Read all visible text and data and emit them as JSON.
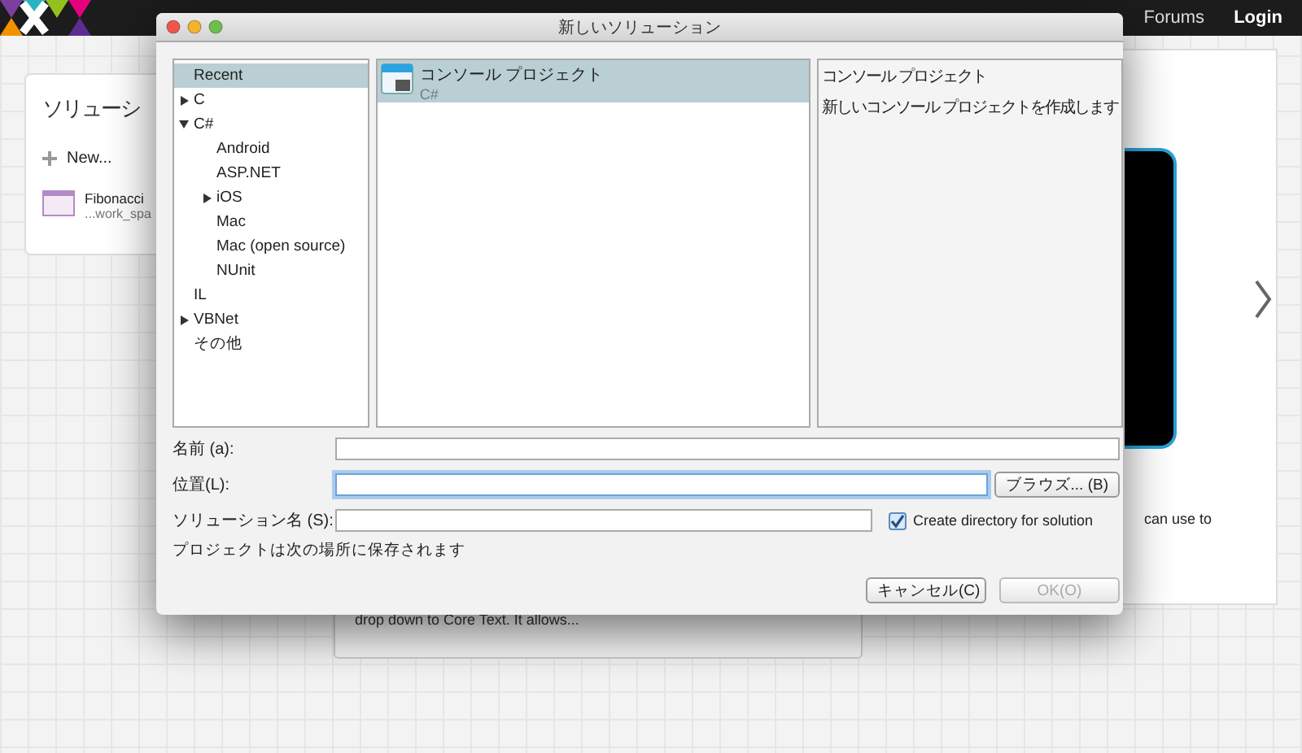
{
  "header": {
    "nav": [
      {
        "label": "Forums"
      },
      {
        "label": "Login"
      }
    ]
  },
  "solutions_card": {
    "title": "ソリューシ",
    "new_label": "New...",
    "recent": [
      {
        "name": "Fibonacci",
        "path": "...work_spa"
      }
    ]
  },
  "sample_card": {
    "text": "drop down to Core Text. It allows..."
  },
  "preview_card": {
    "text": "can use to"
  },
  "dialog": {
    "title": "新しいソリューション",
    "categories": [
      {
        "label": "Recent",
        "selected": true
      },
      {
        "label": "C",
        "selected": false,
        "expanded": false
      },
      {
        "label": "C#",
        "selected": false,
        "expanded": true,
        "children": [
          {
            "label": "Android",
            "selected": false
          },
          {
            "label": "ASP.NET",
            "selected": false
          },
          {
            "label": "iOS",
            "selected": false,
            "expanded": false
          },
          {
            "label": "Mac",
            "selected": false
          },
          {
            "label": "Mac (open source)",
            "selected": false
          },
          {
            "label": "NUnit",
            "selected": false
          }
        ]
      },
      {
        "label": "IL",
        "selected": false
      },
      {
        "label": "VBNet",
        "selected": false,
        "expanded": false
      },
      {
        "label": "その他",
        "selected": false
      }
    ],
    "templates": [
      {
        "name": "コンソール プロジェクト",
        "language": "C#",
        "selected": true
      }
    ],
    "description": {
      "title": "コンソール プロジェクト",
      "text": "新しいコンソール プロジェクトを作成します"
    },
    "fields": [
      {
        "label": "名前 (a):",
        "focused": false
      },
      {
        "label": "位置(L):",
        "focused": true
      },
      {
        "label": "ソリューション名 (S):",
        "focused": false
      }
    ],
    "browse_button": "ブラウズ... (B)",
    "create_directory": {
      "label": "Create directory for solution",
      "checked": true
    },
    "note": "プロジェクトは次の場所に保存されます",
    "buttons": [
      {
        "label": "キャンセル(C)",
        "disabled": false
      },
      {
        "label": "OK(O)",
        "disabled": true
      }
    ]
  }
}
